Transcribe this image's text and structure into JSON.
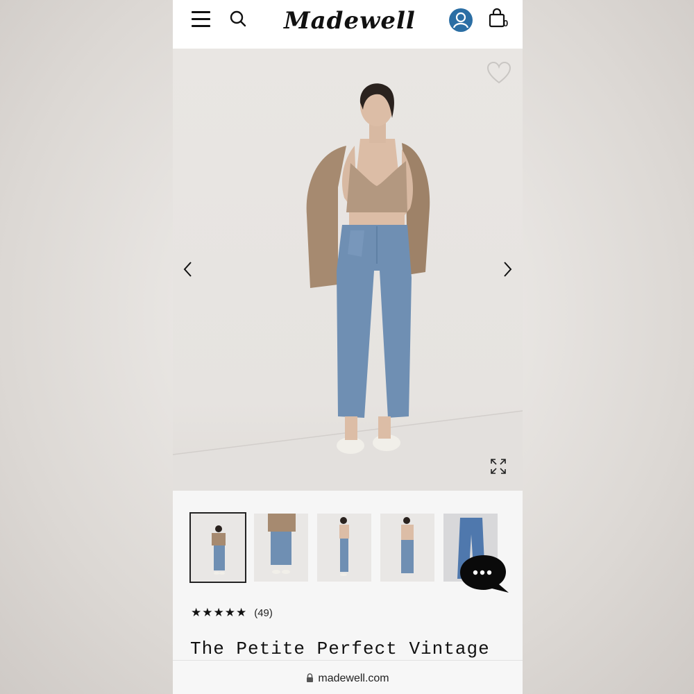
{
  "header": {
    "logo_text": "Madewell",
    "bag_count": "0",
    "accent_color": "#2b6ea4"
  },
  "hero": {
    "icons": [
      "heart-icon",
      "chevron-left-icon",
      "chevron-right-icon",
      "expand-icon"
    ]
  },
  "thumbnails": {
    "count": 5,
    "active_index": 0
  },
  "product": {
    "rating_stars": "★★★★★",
    "rating_value": 5,
    "review_count": "(49)",
    "title": "The Petite Perfect Vintage"
  },
  "browser": {
    "url": "madewell.com"
  }
}
